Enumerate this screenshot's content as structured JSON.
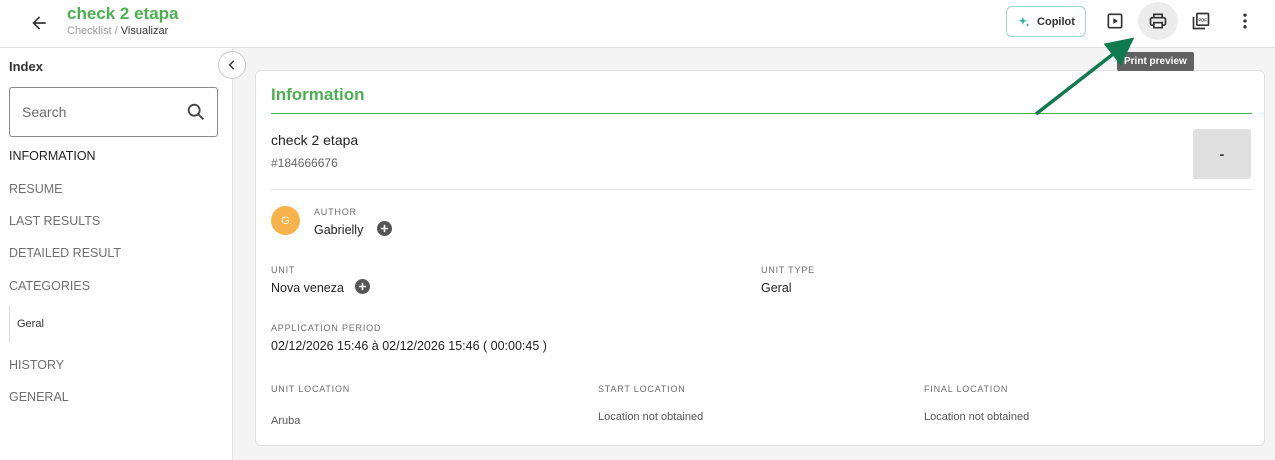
{
  "header": {
    "title": "check 2 etapa",
    "breadcrumb_parent": "Checklist",
    "breadcrumb_sep": " / ",
    "breadcrumb_current": "Visualizar",
    "copilot_label": "Copilot",
    "tooltip": "Print preview",
    "accent_color": "#4caf50"
  },
  "sidebar": {
    "title": "Index",
    "search_placeholder": "Search",
    "items": [
      {
        "label": "INFORMATION"
      },
      {
        "label": "RESUME"
      },
      {
        "label": "LAST RESULTS"
      },
      {
        "label": "DETAILED RESULT"
      },
      {
        "label": "CATEGORIES"
      },
      {
        "label": "HISTORY"
      },
      {
        "label": "GENERAL"
      }
    ],
    "sub_items": [
      {
        "label": "Geral"
      }
    ]
  },
  "main": {
    "section_title": "Information",
    "check_name": "check 2 etapa",
    "check_id": "#184666676",
    "score": "-",
    "author_label": "AUTHOR",
    "author_initial": "G",
    "author_name": "Gabrielly",
    "unit_label": "UNIT",
    "unit_value": "Nova veneza",
    "unit_type_label": "UNIT TYPE",
    "unit_type_value": "Geral",
    "period_label": "APPLICATION PERIOD",
    "period_value": "02/12/2026 15:46 à 02/12/2026 15:46 ( 00:00:45 )",
    "unit_location_label": "UNIT LOCATION",
    "unit_location_value": "Aruba",
    "start_location_label": "START LOCATION",
    "start_location_value": "Location not obtained",
    "final_location_label": "FINAL LOCATION",
    "final_location_value": "Location not obtained"
  },
  "icons": {
    "back": "arrow-left-icon",
    "copilot": "sparkle-icon",
    "play": "play-box-icon",
    "print": "printer-icon",
    "pdf": "pdf-icon",
    "more": "more-vertical-icon",
    "search": "search-icon",
    "collapse": "chevron-left-icon",
    "add": "plus-circle-icon"
  },
  "annotation_color": "#0e7a4f"
}
